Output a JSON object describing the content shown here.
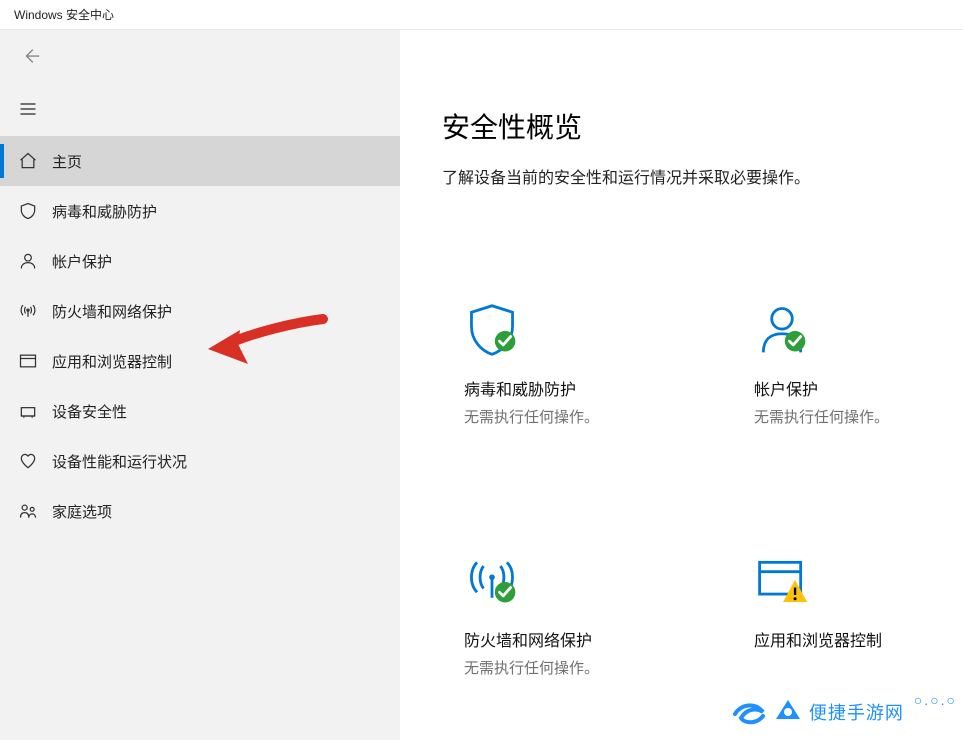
{
  "window": {
    "title": "Windows 安全中心"
  },
  "sidebar": {
    "items": [
      {
        "label": "主页"
      },
      {
        "label": "病毒和威胁防护"
      },
      {
        "label": "帐户保护"
      },
      {
        "label": "防火墙和网络保护"
      },
      {
        "label": "应用和浏览器控制"
      },
      {
        "label": "设备安全性"
      },
      {
        "label": "设备性能和运行状况"
      },
      {
        "label": "家庭选项"
      }
    ]
  },
  "main": {
    "title": "安全性概览",
    "subtitle": "了解设备当前的安全性和运行情况并采取必要操作。",
    "cards": [
      {
        "title": "病毒和威胁防护",
        "status": "无需执行任何操作。"
      },
      {
        "title": "帐户保护",
        "status": "无需执行任何操作。"
      },
      {
        "title": "防火墙和网络保护",
        "status": "无需执行任何操作。"
      },
      {
        "title": "应用和浏览器控制",
        "status": ""
      }
    ]
  },
  "watermark": {
    "text": "便捷手游网",
    "dots": "○.○.○"
  }
}
